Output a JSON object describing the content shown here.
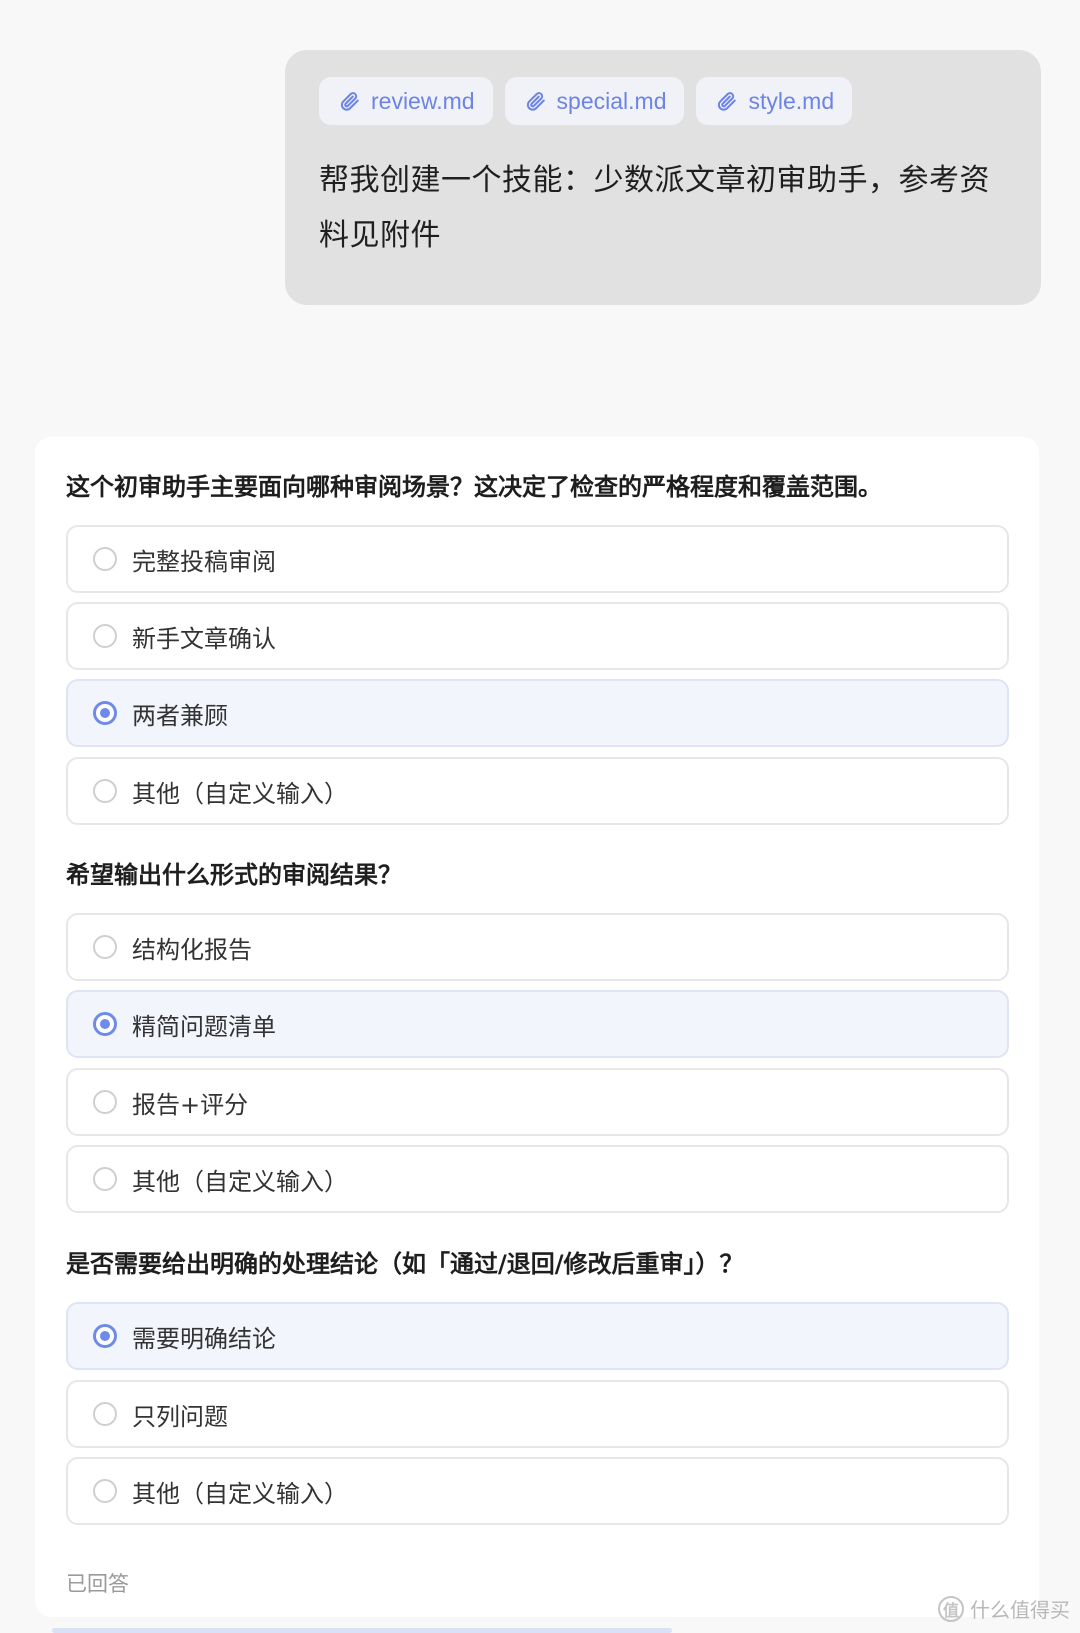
{
  "attachments": [
    {
      "name": "review.md",
      "icon": "paperclip-icon"
    },
    {
      "name": "special.md",
      "icon": "paperclip-icon"
    },
    {
      "name": "style.md",
      "icon": "paperclip-icon"
    }
  ],
  "user_message": {
    "line1": "帮我创建一个技能：少数派文章初审助手，参考资",
    "line2": "料见附件"
  },
  "questions": [
    {
      "title": "这个初审助手主要面向哪种审阅场景？这决定了检查的严格程度和覆盖范围。",
      "options": [
        {
          "label": "完整投稿审阅",
          "selected": false
        },
        {
          "label": "新手文章确认",
          "selected": false
        },
        {
          "label": "两者兼顾",
          "selected": true
        },
        {
          "label": "其他（自定义输入）",
          "selected": false
        }
      ]
    },
    {
      "title": "希望输出什么形式的审阅结果？",
      "options": [
        {
          "label": "结构化报告",
          "selected": false
        },
        {
          "label": "精简问题清单",
          "selected": true
        },
        {
          "label": "报告+评分",
          "selected": false
        },
        {
          "label": "其他（自定义输入）",
          "selected": false
        }
      ]
    },
    {
      "title": "是否需要给出明确的处理结论（如「通过/退回/修改后重审」）？",
      "options": [
        {
          "label": "需要明确结论",
          "selected": true
        },
        {
          "label": "只列问题",
          "selected": false
        },
        {
          "label": "其他（自定义输入）",
          "selected": false
        }
      ]
    }
  ],
  "status": "已回答",
  "watermark": {
    "logo": "值",
    "text": "什么值得买"
  },
  "colors": {
    "accent": "#6f8be9",
    "chip_text": "#6b84e6",
    "bubble_bg": "#e1e1e1",
    "selected_bg": "#f3f5fc"
  }
}
